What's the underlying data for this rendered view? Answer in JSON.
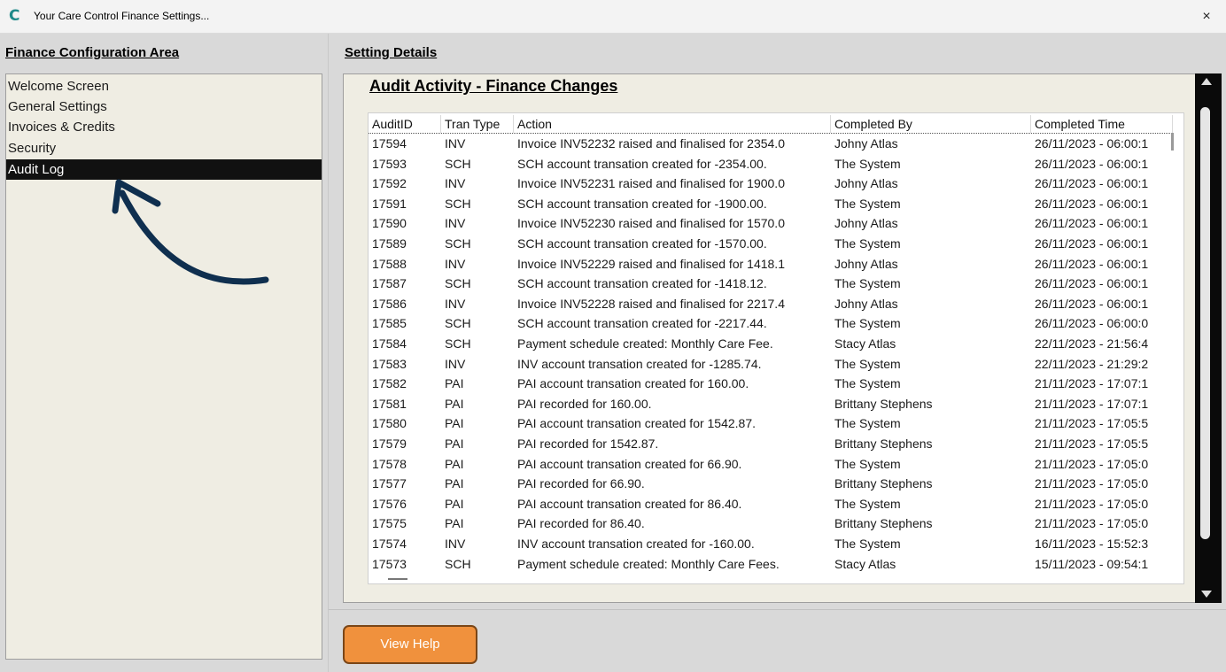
{
  "window": {
    "title": "Your Care Control Finance Settings...",
    "close_label": "×",
    "app_icon": "C"
  },
  "left": {
    "heading": "Finance Configuration Area",
    "items": [
      {
        "label": "Welcome Screen"
      },
      {
        "label": "General Settings"
      },
      {
        "label": "Invoices & Credits"
      },
      {
        "label": "Security"
      },
      {
        "label": "Audit Log",
        "active": true
      }
    ]
  },
  "right": {
    "heading": "Setting Details",
    "panel_title": "Audit Activity - Finance Changes",
    "columns": [
      "AuditID",
      "Tran Type",
      "Action",
      "Completed By",
      "Completed Time"
    ],
    "rows": [
      [
        "17594",
        "INV",
        "Invoice INV52232  raised and finalised for 2354.0",
        "Johny Atlas",
        "26/11/2023 - 06:00:1"
      ],
      [
        "17593",
        "SCH",
        "SCH account transation created for -2354.00.",
        "The System",
        "26/11/2023 - 06:00:1"
      ],
      [
        "17592",
        "INV",
        "Invoice INV52231  raised and finalised for 1900.0",
        "Johny Atlas",
        "26/11/2023 - 06:00:1"
      ],
      [
        "17591",
        "SCH",
        "SCH account transation created for -1900.00.",
        "The System",
        "26/11/2023 - 06:00:1"
      ],
      [
        "17590",
        "INV",
        "Invoice INV52230  raised and finalised for 1570.0",
        "Johny Atlas",
        "26/11/2023 - 06:00:1"
      ],
      [
        "17589",
        "SCH",
        "SCH account transation created for -1570.00.",
        "The System",
        "26/11/2023 - 06:00:1"
      ],
      [
        "17588",
        "INV",
        "Invoice INV52229  raised and finalised for 1418.1",
        "Johny Atlas",
        "26/11/2023 - 06:00:1"
      ],
      [
        "17587",
        "SCH",
        "SCH account transation created for -1418.12.",
        "The System",
        "26/11/2023 - 06:00:1"
      ],
      [
        "17586",
        "INV",
        "Invoice INV52228  raised and finalised for 2217.4",
        "Johny Atlas",
        "26/11/2023 - 06:00:1"
      ],
      [
        "17585",
        "SCH",
        "SCH account transation created for -2217.44.",
        "The System",
        "26/11/2023 - 06:00:0"
      ],
      [
        "17584",
        "SCH",
        "Payment schedule created:  Monthly Care Fee.",
        "Stacy Atlas",
        "22/11/2023 - 21:56:4"
      ],
      [
        "17583",
        "INV",
        "INV account transation created for -1285.74.",
        "The System",
        "22/11/2023 - 21:29:2"
      ],
      [
        "17582",
        "PAI",
        "PAI account transation created for 160.00.",
        "The System",
        "21/11/2023 - 17:07:1"
      ],
      [
        "17581",
        "PAI",
        "PAI recorded for 160.00.",
        "Brittany Stephens",
        "21/11/2023 - 17:07:1"
      ],
      [
        "17580",
        "PAI",
        "PAI account transation created for 1542.87.",
        "The System",
        "21/11/2023 - 17:05:5"
      ],
      [
        "17579",
        "PAI",
        "PAI recorded for 1542.87.",
        "Brittany Stephens",
        "21/11/2023 - 17:05:5"
      ],
      [
        "17578",
        "PAI",
        "PAI account transation created for 66.90.",
        "The System",
        "21/11/2023 - 17:05:0"
      ],
      [
        "17577",
        "PAI",
        "PAI recorded for 66.90.",
        "Brittany Stephens",
        "21/11/2023 - 17:05:0"
      ],
      [
        "17576",
        "PAI",
        "PAI account transation created for 86.40.",
        "The System",
        "21/11/2023 - 17:05:0"
      ],
      [
        "17575",
        "PAI",
        "PAI recorded for 86.40.",
        "Brittany Stephens",
        "21/11/2023 - 17:05:0"
      ],
      [
        "17574",
        "INV",
        "INV account transation created for -160.00.",
        "The System",
        "16/11/2023 - 15:52:3"
      ],
      [
        "17573",
        "SCH",
        "Payment schedule created:  Monthly Care Fees.",
        "Stacy Atlas",
        "15/11/2023 - 09:54:1"
      ]
    ]
  },
  "footer": {
    "help_label": "View Help"
  },
  "colors": {
    "accent": "#f0913d",
    "selected": "#111111",
    "panel": "#efede3",
    "arrow": "#0f2f4f"
  }
}
